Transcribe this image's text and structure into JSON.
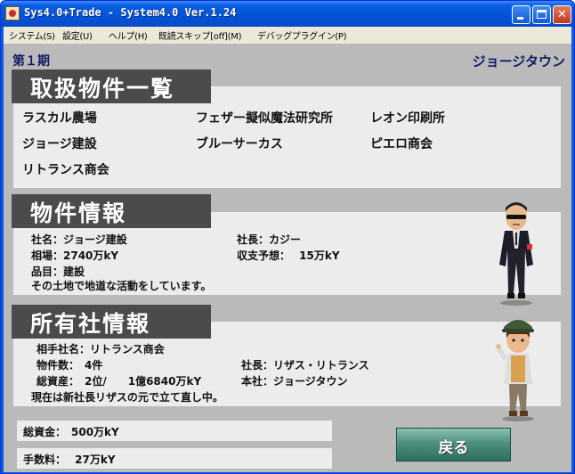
{
  "window": {
    "title": "Sys4.0+Trade - System4.0 Ver.1.24"
  },
  "menu": [
    {
      "label": "システム(S)"
    },
    {
      "label": "設定(U)"
    },
    {
      "label": "ヘルプ(H)"
    },
    {
      "label": "既読スキップ[off](M)"
    },
    {
      "label": "デバッグプラグイン(P)"
    }
  ],
  "header": {
    "period": "第１期",
    "location": "ジョージタウン"
  },
  "properties": {
    "title": "取扱物件一覧",
    "items": [
      "ラスカル農場",
      "フェザー擬似魔法研究所",
      "レオン印刷所",
      "ジョージ建設",
      "ブルーサーカス",
      "ピエロ商会",
      "リトランス商会"
    ]
  },
  "property_info": {
    "title": "物件情報",
    "name": "社名：ジョージ建設",
    "president": "社長：カジー",
    "market": "相場：2740万kY",
    "forecast": "収支予想：　 15万kY",
    "category": "品目：建設",
    "description": "その土地で地道な活動をしています。"
  },
  "owner_info": {
    "title": "所有社情報",
    "partner": "相手社名：リトランス商会",
    "count": "物件数：　4件",
    "president": "社長：リザス・リトランス",
    "assets": "総資産：　2位/　　1億6840万kY",
    "hq": "本社：ジョージタウン",
    "description": "現在は新社長リザスの元で立て直し中。"
  },
  "funds": {
    "total": "総資金：　500万kY",
    "fee": "手数料：　 27万kY"
  },
  "back_button": "戻る",
  "colors": {
    "titlebar": "#0a5ce0",
    "section_header": "#4b4b4b",
    "panel": "#ececec",
    "background": "#bababa",
    "accent_text": "#111c62",
    "button": "#4f8f7f"
  }
}
